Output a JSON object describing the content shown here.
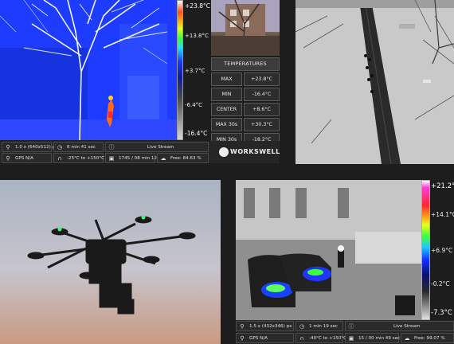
{
  "top_left": {
    "scale": {
      "max": "+23.8°C",
      "t1": "+13.8°C",
      "t2": "+3.7°C",
      "t3": "-6.4°C",
      "min": "-16.4°C"
    },
    "temperatures": {
      "title": "TEMPERATURES",
      "rows": [
        {
          "label": "MAX",
          "value": "+23.8°C"
        },
        {
          "label": "MIN",
          "value": "-16.4°C"
        },
        {
          "label": "CENTER",
          "value": "+8.6°C"
        },
        {
          "label": "MAX 30s",
          "value": "+30.3°C"
        },
        {
          "label": "MIN 30s",
          "value": "-18.2°C"
        }
      ]
    },
    "status": {
      "zoom": "1.0 x (640x512) px",
      "duration": "6 min 41 sec",
      "mode": "Live Stream",
      "gps": "GPS N/A",
      "range": "-25°C to +150°C",
      "frames": "1745 / 08 min 12 sec",
      "storage": "Free: 84.63 %"
    },
    "logo": "WORKSWELL"
  },
  "bottom_right": {
    "scale": {
      "max": "+21.2°C",
      "t1": "+14.1°C",
      "t2": "+6.9°C",
      "t3": "-0.2°C",
      "min": "-7.3°C"
    },
    "status": {
      "zoom": "1.5 x (432x346) px",
      "duration": "1 min 19 sec",
      "mode": "Live Stream",
      "gps": "GPS N/A",
      "range": "-40°C to +150°C",
      "frames": "15 / 00 min 49 sec",
      "storage": "Free: 99.07 %"
    }
  },
  "icons": {
    "zoom": "magnifier-icon",
    "timer": "timer-icon",
    "info": "info-icon",
    "gps": "location-pin-icon",
    "range": "thermometer-icon",
    "frames": "video-icon",
    "storage": "cloud-icon"
  }
}
